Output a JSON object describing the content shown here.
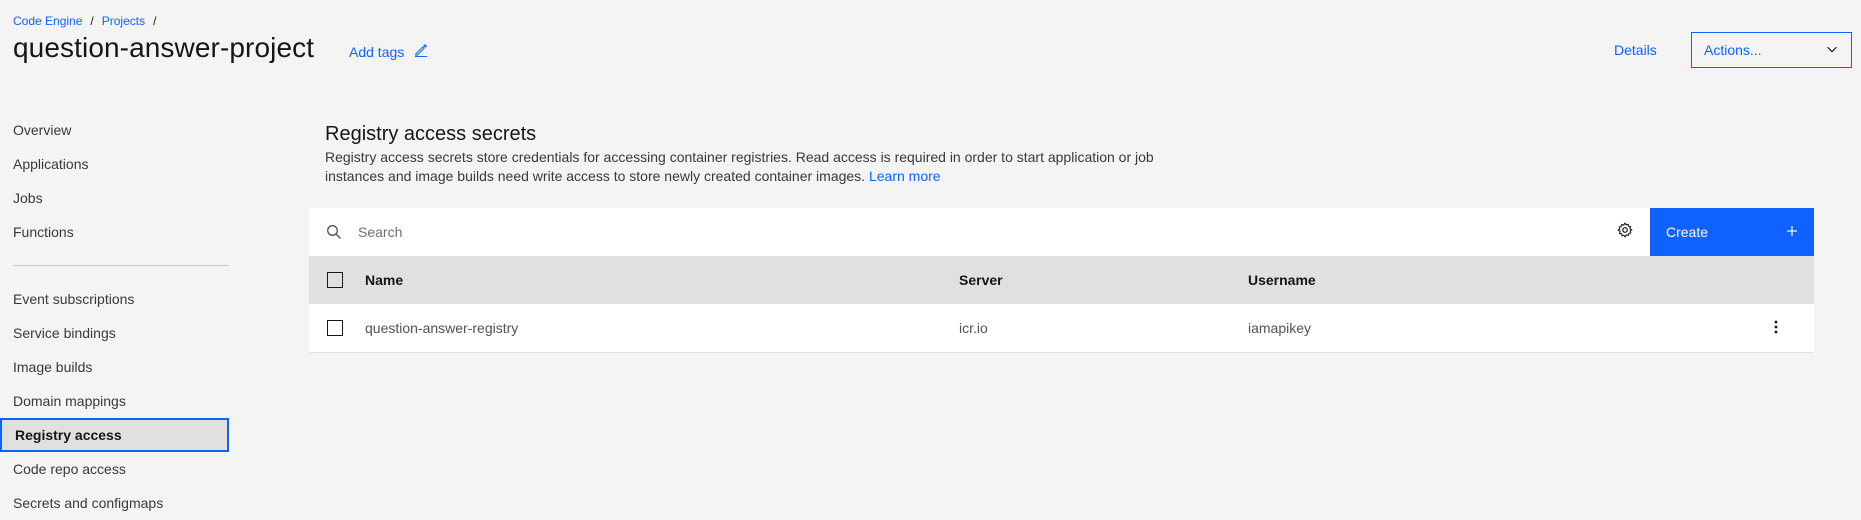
{
  "breadcrumb": {
    "items": [
      "Code Engine",
      "Projects"
    ],
    "separator": "/"
  },
  "header": {
    "title": "question-answer-project",
    "add_tags": "Add tags",
    "details": "Details",
    "actions": "Actions..."
  },
  "sidebar": {
    "items_top": [
      "Overview",
      "Applications",
      "Jobs",
      "Functions"
    ],
    "items_bottom": [
      "Event subscriptions",
      "Service bindings",
      "Image builds",
      "Domain mappings",
      "Registry access",
      "Code repo access",
      "Secrets and configmaps"
    ],
    "active": "Registry access"
  },
  "main": {
    "title": "Registry access secrets",
    "description": "Registry access secrets store credentials for accessing container registries. Read access is required in order to start application or job instances and image builds need write access to store newly created container images.",
    "learn_more": "Learn more"
  },
  "table": {
    "search_placeholder": "Search",
    "create_label": "Create",
    "columns": [
      "Name",
      "Server",
      "Username"
    ],
    "rows": [
      {
        "name": "question-answer-registry",
        "server": "icr.io",
        "username": "iamapikey"
      }
    ]
  },
  "colors": {
    "accent": "#0f62fe",
    "background": "#f4f4f4",
    "header_row": "#e0e0e0"
  }
}
